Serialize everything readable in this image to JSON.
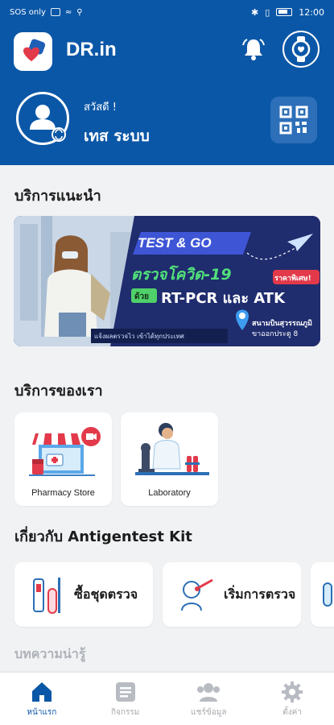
{
  "status_bar": {
    "left_text": "SOS only",
    "time": "12:00"
  },
  "header": {
    "app_name": "DR.in",
    "greeting": "สวัสดี !",
    "user_name": "เทส ระบบ"
  },
  "sections": {
    "recommended_title": "บริการแนะนำ",
    "services_title": "บริการของเรา",
    "kit_title": "เกี่ยวกับ Antigentest Kit",
    "next_title_faded": "บทความน่ารู้"
  },
  "banner": {
    "headline": "TEST & GO",
    "line1": "ตรวจโควิด-19",
    "with_label": "ด้วย",
    "line2": "RT-PCR และ ATK",
    "badge": "ราคาพิเศษ!",
    "footer_left": "แจ้งผลตรวจไว เข้าได้ทุกประเทศ",
    "location_line1": "สนามบินสุวรรณภูมิ",
    "location_line2": "ขาออกประตู 8"
  },
  "services": [
    {
      "label": "Pharmacy Store"
    },
    {
      "label": "Laboratory"
    }
  ],
  "kit_actions": [
    {
      "label": "ซื้อชุดตรวจ"
    },
    {
      "label": "เริ่มการตรวจ"
    }
  ],
  "bottom_nav": [
    {
      "label": "หน้าแรก",
      "active": true
    },
    {
      "label": "กิจกรรม"
    },
    {
      "label": "แชร์ข้อมูล"
    },
    {
      "label": "ตั้งค่า"
    }
  ],
  "colors": {
    "primary": "#0b57a7",
    "accent_red": "#e23a4a",
    "background": "#f1f2f4"
  }
}
